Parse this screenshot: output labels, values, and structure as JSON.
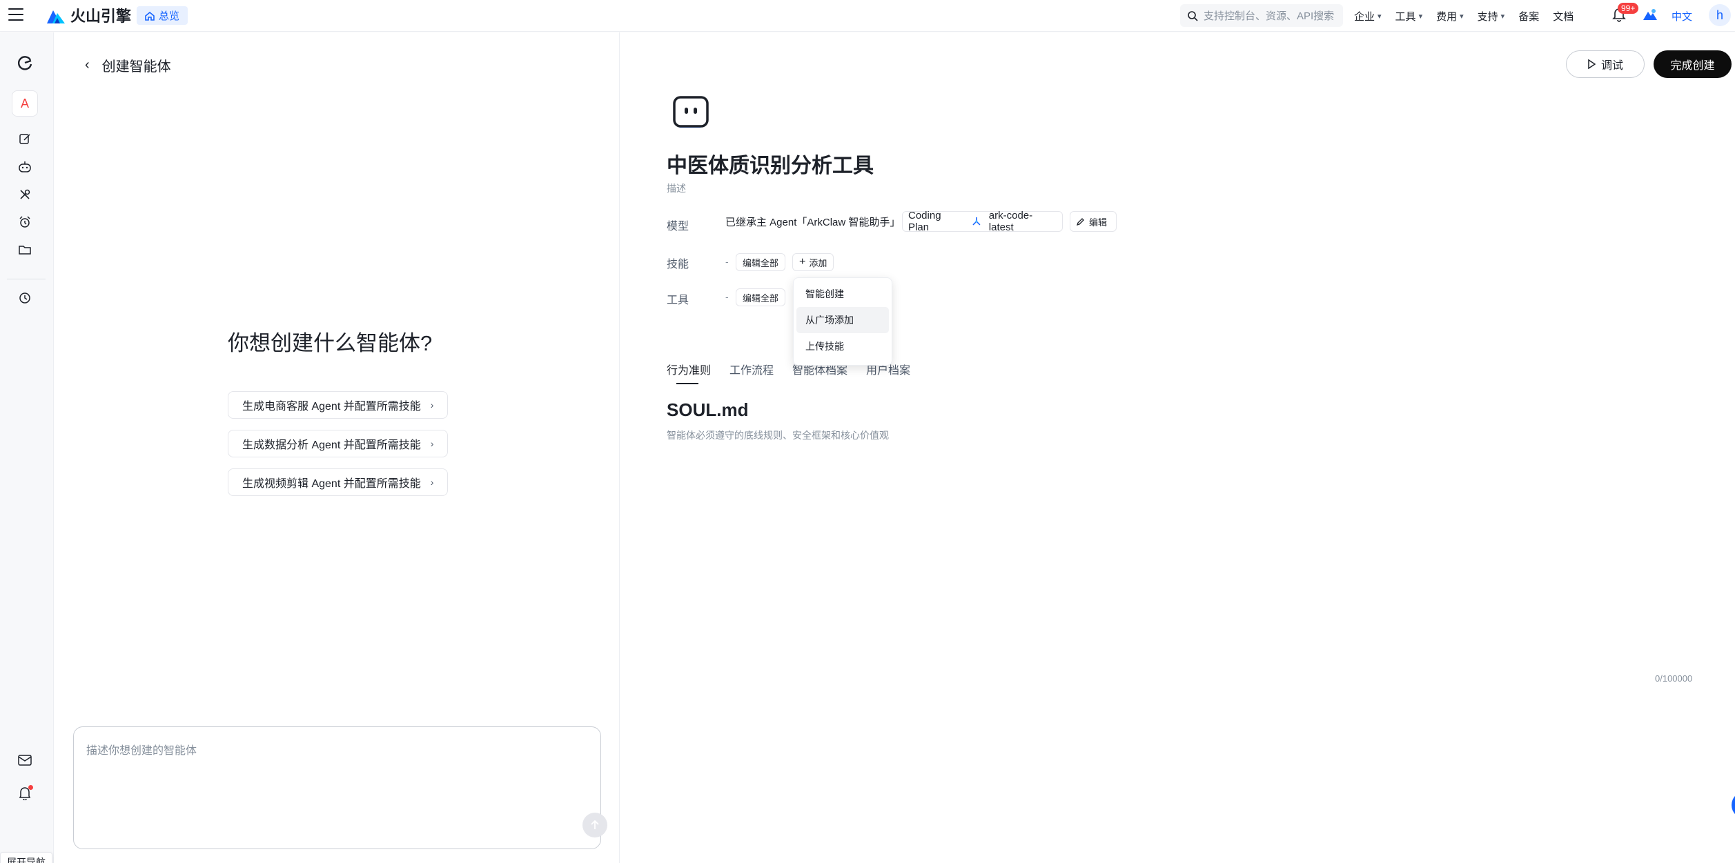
{
  "topbar": {
    "brand": "火山引擎",
    "overview_chip": "总览",
    "search_placeholder": "支持控制台、资源、API搜索",
    "nav": [
      "企业",
      "工具",
      "费用",
      "支持",
      "备案",
      "文档"
    ],
    "notification_badge": "99+",
    "language": "中文",
    "user_initial": "h"
  },
  "sidebar": {
    "avatar_letter": "A",
    "expand_nav": "展开导航"
  },
  "left_panel": {
    "back_title": "创建智能体",
    "heading": "你想创建什么智能体?",
    "suggestions": [
      "生成电商客服 Agent 并配置所需技能",
      "生成数据分析 Agent 并配置所需技能",
      "生成视频剪辑 Agent 并配置所需技能"
    ],
    "input_placeholder": "描述你想创建的智能体"
  },
  "right_panel": {
    "debug_button": "调试",
    "finish_button": "完成创建",
    "agent_name": "中医体质识别分析工具",
    "description_placeholder": "描述",
    "model": {
      "label": "模型",
      "inherited_text": "已继承主 Agent「ArkClaw 智能助手」",
      "plan": "Coding Plan",
      "model_name": "ark-code-latest",
      "edit": "编辑"
    },
    "skills": {
      "label": "技能",
      "value": "-",
      "edit_all": "编辑全部",
      "add": "添加"
    },
    "tools": {
      "label": "工具",
      "value": "-",
      "edit_all": "编辑全部"
    },
    "add_menu": [
      "智能创建",
      "从广场添加",
      "上传技能"
    ],
    "tabs": [
      "行为准则",
      "工作流程",
      "智能体档案",
      "用户档案"
    ],
    "doc_title": "SOUL.md",
    "doc_subtitle": "智能体必须遵守的底线规则、安全框架和核心价值观",
    "char_count": "0/100000"
  }
}
